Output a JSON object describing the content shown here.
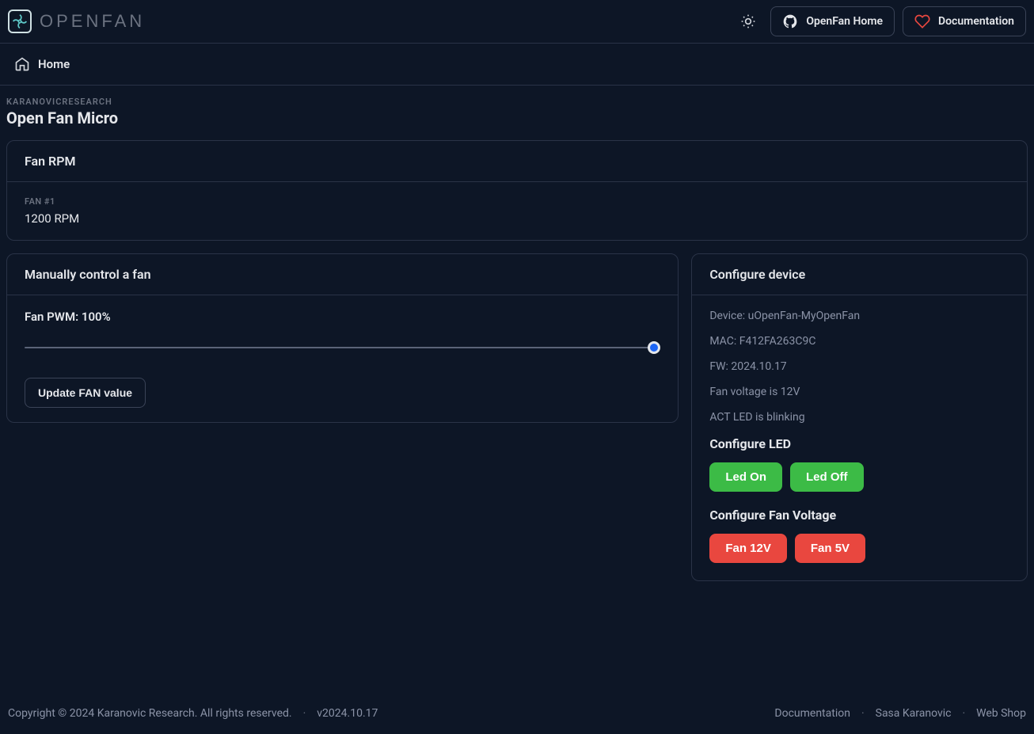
{
  "header": {
    "brand": "OPENFAN",
    "home_link": "OpenFan Home",
    "docs_link": "Documentation"
  },
  "breadcrumb": {
    "home": "Home"
  },
  "page": {
    "org": "KARANOVICRESEARCH",
    "title": "Open Fan Micro"
  },
  "fan_rpm": {
    "card_title": "Fan RPM",
    "label": "FAN #1",
    "value": "1200 RPM"
  },
  "manual_control": {
    "card_title": "Manually control a fan",
    "pwm_label": "Fan PWM: 100%",
    "update_btn": "Update FAN value"
  },
  "configure": {
    "card_title": "Configure device",
    "device": "Device: uOpenFan-MyOpenFan",
    "mac": "MAC: F412FA263C9C",
    "fw": "FW: 2024.10.17",
    "voltage": "Fan voltage is 12V",
    "led_status": "ACT LED is blinking",
    "led_heading": "Configure LED",
    "led_on": "Led On",
    "led_off": "Led Off",
    "voltage_heading": "Configure Fan Voltage",
    "fan_12v": "Fan 12V",
    "fan_5v": "Fan 5V"
  },
  "footer": {
    "copyright": "Copyright © 2024 Karanovic Research. All rights reserved.",
    "version": "v2024.10.17",
    "docs": "Documentation",
    "author": "Sasa Karanovic",
    "shop": "Web Shop"
  }
}
